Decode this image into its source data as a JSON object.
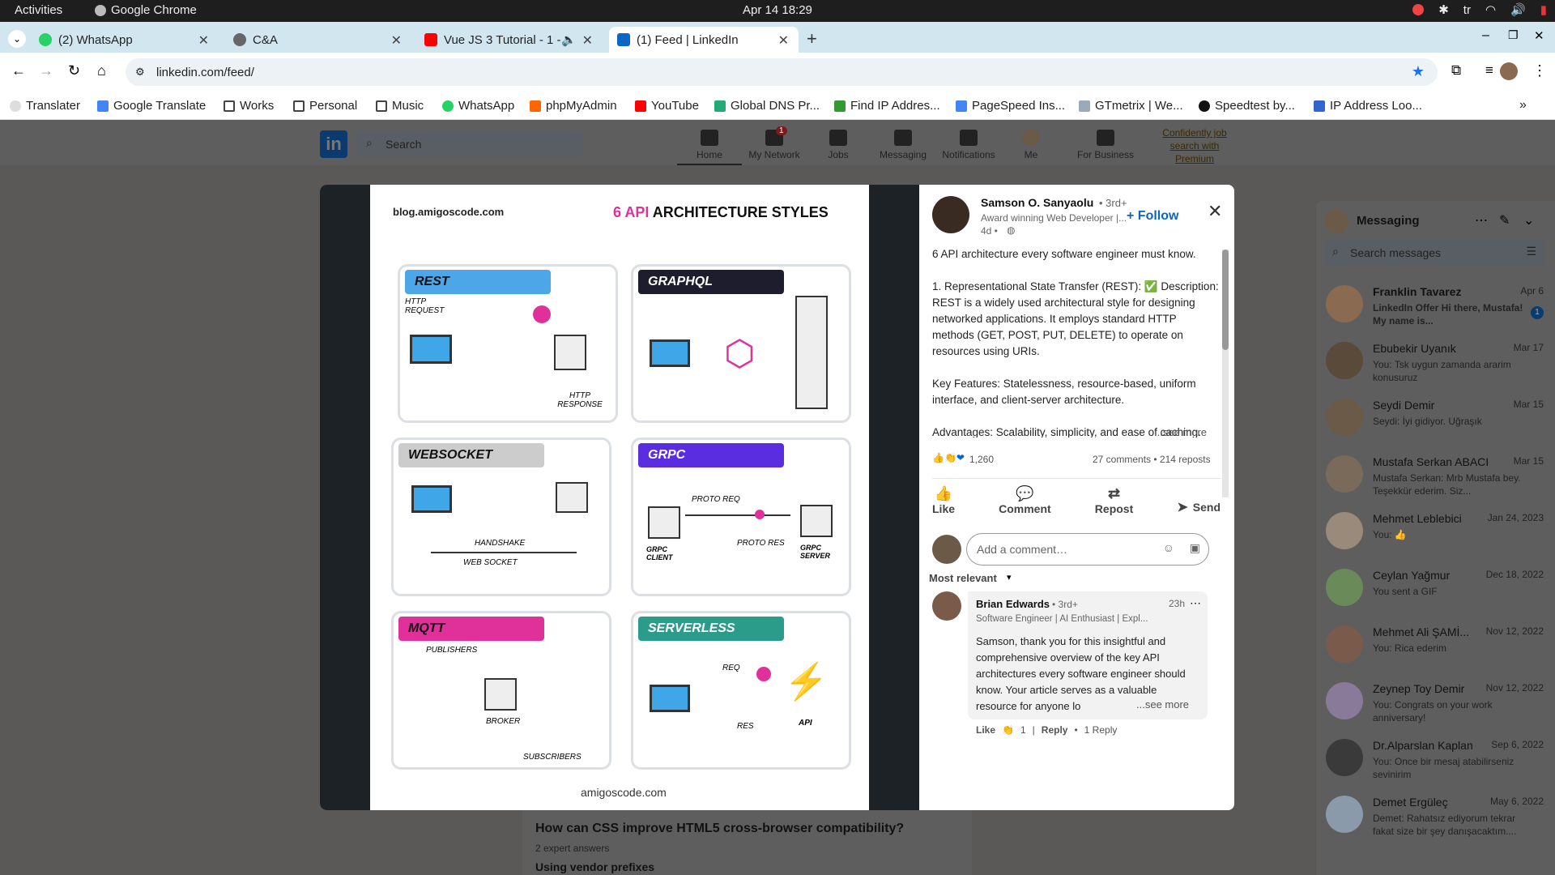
{
  "gnome": {
    "activities": "Activities",
    "app": "Google Chrome",
    "clock": "Apr 14  18:29",
    "lang": "tr"
  },
  "tabs": [
    {
      "label": "(2) WhatsApp"
    },
    {
      "label": "C&A"
    },
    {
      "label": "Vue JS 3 Tutorial - 1 -"
    },
    {
      "label": "(1) Feed | LinkedIn"
    }
  ],
  "url": "linkedin.com/feed/",
  "bookmarks": [
    "Translater",
    "Google Translate",
    "Works",
    "Personal",
    "Music",
    "WhatsApp",
    "phpMyAdmin",
    "YouTube",
    "Global DNS Pr...",
    "Find IP Addres...",
    "PageSpeed Ins...",
    "GTmetrix | We...",
    "Speedtest by...",
    "IP Address Loo..."
  ],
  "linkedin": {
    "search_placeholder": "Search",
    "nav": [
      "Home",
      "My Network",
      "Jobs",
      "Messaging",
      "Notifications",
      "Me",
      "For Business"
    ],
    "network_badge": "1",
    "premium": "Confidently job search with Premium"
  },
  "infographic": {
    "site": "blog.amigoscode.com",
    "title_accent": "6 API",
    "title_rest": "ARCHITECTURE STYLES",
    "footer": "amigoscode.com",
    "cards": [
      {
        "name": "REST",
        "l1": "HTTP REQUEST",
        "l2": "HTTP RESPONSE"
      },
      {
        "name": "GRAPHQL"
      },
      {
        "name": "WEBSOCKET",
        "l1": "HANDSHAKE",
        "l2": "WEB SOCKET"
      },
      {
        "name": "GRPC",
        "l1": "PROTO REQ",
        "l2": "PROTO RES",
        "l3": "GRPC CLIENT",
        "l4": "GRPC SERVER"
      },
      {
        "name": "MQTT",
        "l1": "PUBLISHERS",
        "l2": "BROKER",
        "l3": "SUBSCRIBERS"
      },
      {
        "name": "SERVERLESS",
        "l1": "REQ",
        "l2": "RES",
        "l3": "API"
      }
    ]
  },
  "post": {
    "author": "Samson O. Sanyaolu",
    "degree": "• 3rd+",
    "headline": "Award winning Web Developer |...",
    "time": "4d •",
    "follow": "+ Follow",
    "body": [
      "6 API architecture every software engineer must know.",
      "1. Representational State Transfer (REST): ✅ Description: REST is a widely used architectural style for designing networked applications. It employs standard HTTP methods (GET, POST, PUT, DELETE) to operate on resources using URIs.",
      "Key Features: Statelessness, resource-based, uniform interface, and client-server architecture.",
      "Advantages: Scalability, simplicity, and ease of caching."
    ],
    "see_more": "...see more",
    "reactions": "1,260",
    "comments_reposts": "27 comments • 214 reposts",
    "actions": [
      "Like",
      "Comment",
      "Repost",
      "Send"
    ],
    "add_comment": "Add a comment…",
    "sort": "Most relevant"
  },
  "comment": {
    "author": "Brian Edwards",
    "degree": "• 3rd+",
    "time": "23h",
    "headline": "Software Engineer | AI Enthusiast | Expl...",
    "text": "Samson, thank you for this insightful and comprehensive overview of the key API architectures every software engineer should know. Your article serves as a valuable resource for anyone lo",
    "see_more": "...see more",
    "like": "Like",
    "likes": "1",
    "reply": "Reply",
    "replies": "1 Reply"
  },
  "feed_behind": {
    "q": "How can CSS improve HTML5 cross-browser compatibility?",
    "experts": "2 expert answers",
    "sub": "Using vendor prefixes"
  },
  "messaging": {
    "title": "Messaging",
    "search": "Search messages",
    "items": [
      {
        "name": "Franklin Tavarez",
        "date": "Apr 6",
        "preview": "LinkedIn Offer  Hi there, Mustafa! My name is...",
        "unread": "1"
      },
      {
        "name": "Ebubekir Uyanık",
        "date": "Mar 17",
        "preview": "You: Tsk uygun zamanda ararim konusuruz"
      },
      {
        "name": "Seydi Demir",
        "date": "Mar 15",
        "preview": "Seydi: İyi gidiyor. Uğraşık"
      },
      {
        "name": "Mustafa Serkan ABACI",
        "date": "Mar 15",
        "preview": "Mustafa Serkan: Mrb Mustafa bey. Teşekkür ederim. Siz..."
      },
      {
        "name": "Mehmet Leblebici",
        "date": "Jan 24, 2023",
        "preview": "You: 👍"
      },
      {
        "name": "Ceylan Yağmur",
        "date": "Dec 18, 2022",
        "preview": "You sent a GIF"
      },
      {
        "name": "Mehmet Ali ŞAMİ...",
        "date": "Nov 12, 2022",
        "preview": "You: Rica ederim"
      },
      {
        "name": "Zeynep Toy Demir",
        "date": "Nov 12, 2022",
        "preview": "You: Congrats on your work anniversary!"
      },
      {
        "name": "Dr.Alparslan Kaplan",
        "date": "Sep 6, 2022",
        "preview": "You: Once bir mesaj atabilirseniz sevinirim"
      },
      {
        "name": "Demet Ergüleç",
        "date": "May 6, 2022",
        "preview": "Demet: Rahatsız ediyorum tekrar fakat size bir şey danışacaktım...."
      }
    ]
  }
}
